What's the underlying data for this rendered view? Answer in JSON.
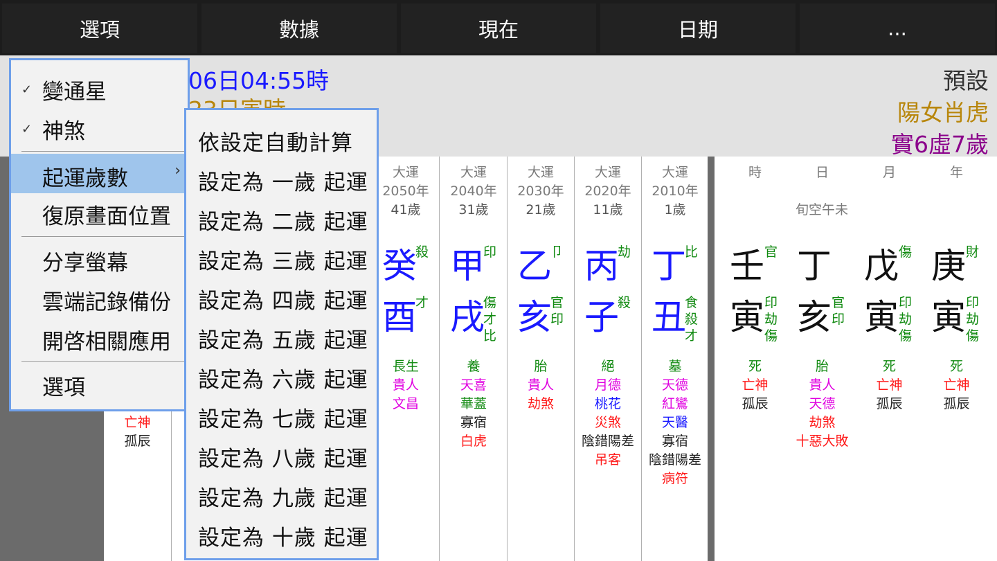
{
  "topbar": {
    "buttons": [
      "選項",
      "數據",
      "現在",
      "日期",
      "..."
    ]
  },
  "header": {
    "line1": "06日04:55時",
    "line2": "23日寅時",
    "right_default": "預設",
    "right_zodiac": "陽女肖虎",
    "right_age": "實6虛7歲",
    "colors": {
      "blue": "#1a1aff",
      "orange": "#b8860b",
      "purple": "#8b008b"
    }
  },
  "menu": {
    "items": [
      {
        "label": "變通星",
        "checked": true
      },
      {
        "label": "神煞",
        "checked": true
      },
      {
        "label": "起運歲數",
        "submenu_arrow": "›"
      },
      {
        "label": "復原畫面位置"
      },
      {
        "label": "分享螢幕"
      },
      {
        "label": "雲端記錄備份"
      },
      {
        "label": "開啓相關應用"
      },
      {
        "label": "選項"
      }
    ],
    "check_mark": "✓"
  },
  "submenu": {
    "items": [
      "依設定自動計算",
      "設定為 一歲 起運",
      "設定為 二歲 起運",
      "設定為 三歲 起運",
      "設定為 四歲 起運",
      "設定為 五歲 起運",
      "設定為 六歲 起運",
      "設定為 七歲 起運",
      "設定為 八歲 起運",
      "設定為 九歲 起運",
      "設定為 十歲 起運"
    ]
  },
  "partial_column": {
    "stars": [
      "亡神",
      "孤辰"
    ]
  },
  "dayun": [
    {
      "label": "大運",
      "year": "2050年",
      "age": "41歲",
      "stem": "癸",
      "stem_god": [
        "殺"
      ],
      "branch": "酉",
      "branch_gods": [
        "才"
      ],
      "phase": "長生",
      "stars": [
        "貴人",
        "文昌"
      ],
      "star_colors": [
        "pink",
        "pink"
      ]
    },
    {
      "label": "大運",
      "year": "2040年",
      "age": "31歲",
      "stem": "甲",
      "stem_god": [
        "印"
      ],
      "branch": "戌",
      "branch_gods": [
        "傷",
        "才",
        "比"
      ],
      "phase": "養",
      "stars": [
        "天喜",
        "華蓋",
        "寡宿",
        "白虎"
      ],
      "star_colors": [
        "pink",
        "green",
        "black",
        "red"
      ]
    },
    {
      "label": "大運",
      "year": "2030年",
      "age": "21歲",
      "stem": "乙",
      "stem_god": [
        "卩"
      ],
      "branch": "亥",
      "branch_gods": [
        "官",
        "印"
      ],
      "phase": "胎",
      "stars": [
        "貴人",
        "劫煞"
      ],
      "star_colors": [
        "pink",
        "red"
      ]
    },
    {
      "label": "大運",
      "year": "2020年",
      "age": "11歲",
      "stem": "丙",
      "stem_god": [
        "劫"
      ],
      "branch": "子",
      "branch_gods": [
        "殺"
      ],
      "phase": "絕",
      "stars": [
        "月德",
        "桃花",
        "災煞",
        "陰錯陽差",
        "吊客"
      ],
      "star_colors": [
        "pink",
        "blue",
        "red",
        "black",
        "red"
      ]
    },
    {
      "label": "大運",
      "year": "2010年",
      "age": "1歲",
      "stem": "丁",
      "stem_god": [
        "比"
      ],
      "branch": "丑",
      "branch_gods": [
        "食",
        "殺",
        "才"
      ],
      "phase": "墓",
      "stars": [
        "天德",
        "紅鸞",
        "天醫",
        "寡宿",
        "陰錯陽差",
        "病符"
      ],
      "star_colors": [
        "pink",
        "pink",
        "blue",
        "black",
        "black",
        "red"
      ]
    }
  ],
  "pillars": {
    "kongwang": "旬空午未",
    "cols": [
      {
        "label": "時",
        "stem": "壬",
        "stem_god": [
          "官"
        ],
        "branch": "寅",
        "branch_gods": [
          "印",
          "劫",
          "傷"
        ],
        "phase": "死",
        "stars": [
          "亡神",
          "孤辰"
        ],
        "star_colors": [
          "red",
          "black"
        ]
      },
      {
        "label": "日",
        "stem": "丁",
        "stem_god": [],
        "branch": "亥",
        "branch_gods": [
          "官",
          "印"
        ],
        "phase": "胎",
        "stars": [
          "貴人",
          "天德",
          "劫煞",
          "十惡大敗"
        ],
        "star_colors": [
          "pink",
          "pink",
          "red",
          "red"
        ]
      },
      {
        "label": "月",
        "stem": "戊",
        "stem_god": [
          "傷"
        ],
        "branch": "寅",
        "branch_gods": [
          "印",
          "劫",
          "傷"
        ],
        "phase": "死",
        "stars": [
          "亡神",
          "孤辰"
        ],
        "star_colors": [
          "red",
          "black"
        ]
      },
      {
        "label": "年",
        "stem": "庚",
        "stem_god": [
          "財"
        ],
        "branch": "寅",
        "branch_gods": [
          "印",
          "劫",
          "傷"
        ],
        "phase": "死",
        "stars": [
          "亡神",
          "孤辰"
        ],
        "star_colors": [
          "red",
          "black"
        ]
      }
    ]
  },
  "palette": {
    "pink": "#e000e0",
    "red": "#ff1a1a",
    "green": "#118a11",
    "blue": "#1a1aff",
    "black": "#222222"
  }
}
